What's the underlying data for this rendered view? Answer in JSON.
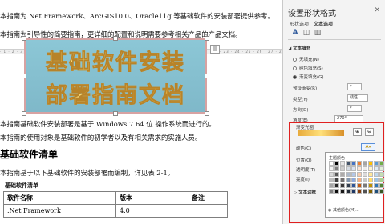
{
  "document": {
    "lines": [
      "本指南为.Net Framework、ArcGIS10.0、Oracle11g 等基础软件的安装部署提供参考。",
      "本指南为引导性的简要指南，更详细的配置和说明需要参考相关产品的产品文档。",
      "本指南基础软件安装部署是基于 Windows 7 64 位 操作系统而进行的。",
      "本指南的使用对象是基础软件的初学者以及有相关需求的实施人员。",
      "本指南基于以下基础软件的安装部署而编制，详见表 2-1。"
    ],
    "banner_lines": [
      "基础软件安装",
      "部署指南文档"
    ],
    "heading": "基础软件清单",
    "table_caption": "基础软件清单",
    "table": {
      "headers": [
        "软件名称",
        "版本",
        "备注"
      ],
      "rows": [
        [
          ".Net Framework",
          "4.0",
          ""
        ]
      ]
    }
  },
  "pane": {
    "title": "设置形状格式",
    "close": "✕",
    "tabs": [
      "形状选项",
      "文本选项"
    ],
    "section": "文本填充",
    "fill_options": [
      "无填充(N)",
      "纯色填充(S)",
      "渐变填充(G)"
    ],
    "preset_label": "预设渐变(R)",
    "type_label": "类型(Y)",
    "type_value": "线性",
    "direction_label": "方向(D)",
    "angle_label": "角度(E)",
    "angle_value": "270°",
    "stops_label": "渐变光圈",
    "color_label": "颜色(C)",
    "position_label": "位置(O)",
    "transparency_label": "透明度(T)",
    "brightness_label": "亮度(I)",
    "outline_label": "文本边框"
  },
  "popup": {
    "title": "主题颜色",
    "more": "其他颜色(M)...",
    "colors": [
      "#ffffff",
      "#000000",
      "#e7e6e6",
      "#44546a",
      "#4472c4",
      "#ed7d31",
      "#a5a5a5",
      "#ffc000",
      "#5b9bd5",
      "#70ad47",
      "#f2f2f2",
      "#7f7f7f",
      "#d0cece",
      "#d6dce4",
      "#dae3f3",
      "#fbe5d6",
      "#ededed",
      "#fff2cc",
      "#deebf7",
      "#e2f0d9",
      "#d9d9d9",
      "#595959",
      "#aeabab",
      "#adb9ca",
      "#b4c7e7",
      "#f8cbad",
      "#dbdbdb",
      "#ffe699",
      "#bdd7ee",
      "#c5e0b4",
      "#bfbfbf",
      "#404040",
      "#757171",
      "#8497b0",
      "#8faadc",
      "#f4b183",
      "#c9c9c9",
      "#ffd966",
      "#9dc3e6",
      "#a9d18e",
      "#a6a6a6",
      "#262626",
      "#3a3838",
      "#333f50",
      "#2f5597",
      "#c55a11",
      "#7b7b7b",
      "#bf9000",
      "#2e75b6",
      "#548235",
      "#808080",
      "#0d0d0d",
      "#171717",
      "#222a35",
      "#1f3864",
      "#843c0c",
      "#525252",
      "#7f6000",
      "#1f4e79",
      "#385723"
    ]
  }
}
